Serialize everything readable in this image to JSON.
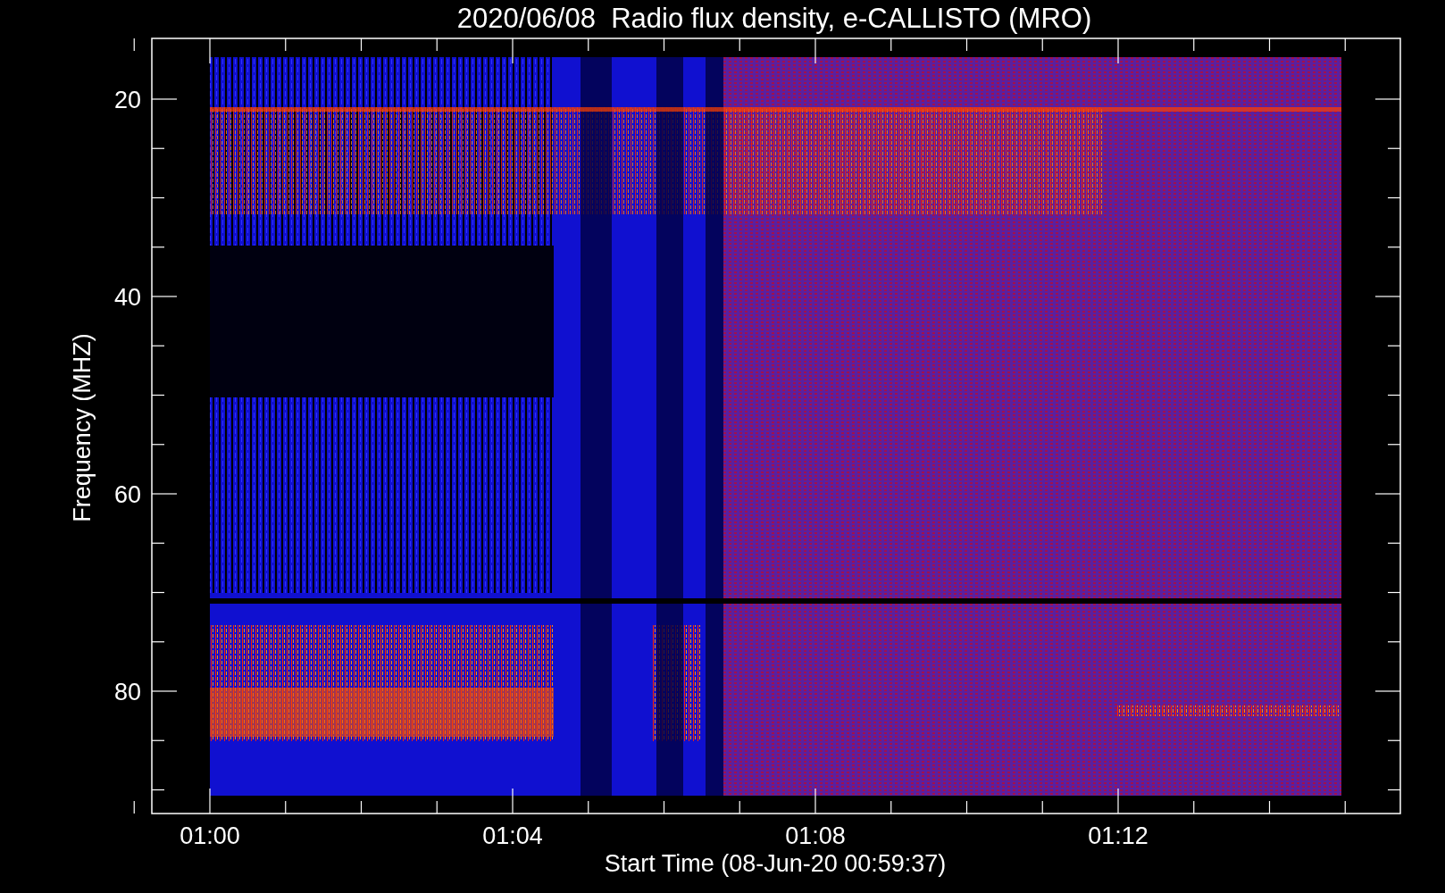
{
  "title": "2020/06/08  Radio flux density, e-CALLISTO (MRO)",
  "ylabel": "Frequency (MHZ)",
  "xlabel": "Start Time (08-Jun-20 00:59:37)",
  "y_tick_labels": [
    "20",
    "40",
    "60",
    "80"
  ],
  "x_tick_labels": [
    "01:00",
    "01:04",
    "01:08",
    "01:12"
  ]
}
